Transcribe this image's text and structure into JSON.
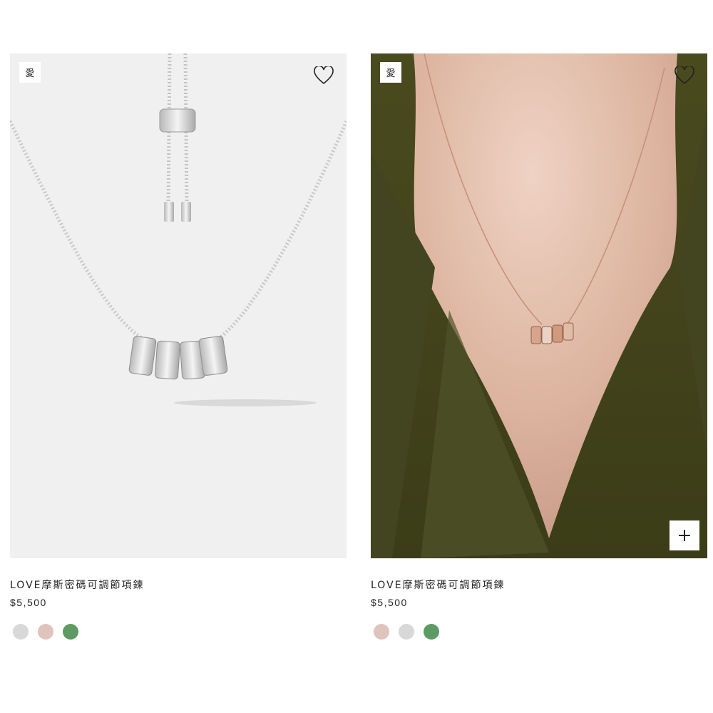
{
  "products": [
    {
      "badge": "愛",
      "name": "LOVE摩斯密碼可調節項鍊",
      "price": "$5,500",
      "image_icon": "silver-necklace-product-photo",
      "swatches": [
        {
          "name": "silver",
          "color": "#d8d8d8"
        },
        {
          "name": "rose-gold",
          "color": "#dfc3bd"
        },
        {
          "name": "green",
          "color": "#5e9b64"
        }
      ]
    },
    {
      "badge": "愛",
      "name": "LOVE摩斯密碼可調節項鍊",
      "price": "$5,500",
      "image_icon": "rose-gold-necklace-model-photo",
      "quick_add": "plus-icon",
      "swatches": [
        {
          "name": "rose-gold",
          "color": "#dfc3bd"
        },
        {
          "name": "silver",
          "color": "#d8d8d8"
        },
        {
          "name": "green",
          "color": "#5e9b64"
        }
      ]
    }
  ]
}
